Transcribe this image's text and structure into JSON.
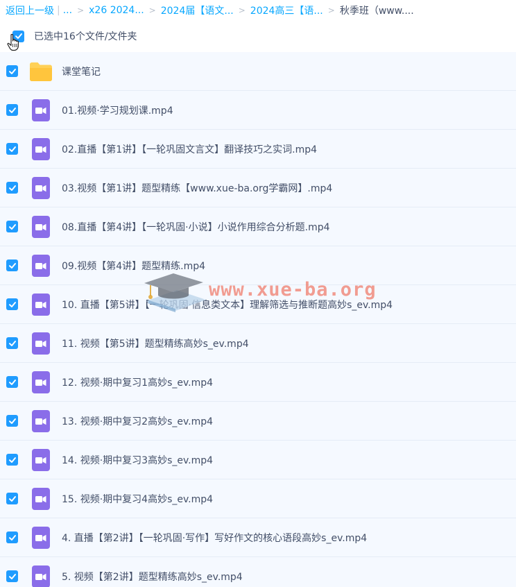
{
  "breadcrumb": {
    "back_label": "返回上一级",
    "divider": "|",
    "ellipsis": "...",
    "separator": ">",
    "items": [
      "x26 2024...",
      "2024届【语文...",
      "2024高三【语...",
      "秋季班（www...."
    ]
  },
  "selection": {
    "label": "已选中16个文件/文件夹"
  },
  "watermark": "www.xue-ba.org",
  "colors": {
    "accent": "#06a7ff",
    "checkbox": "#1f9cff",
    "row_bg": "#f5f9ff",
    "folder": "#ffd157",
    "video_icon": "#8a6de9"
  },
  "files": [
    {
      "name": "课堂笔记",
      "icon": "folder-icon"
    },
    {
      "name": "01.视频·学习规划课.mp4",
      "icon": "video-file-icon"
    },
    {
      "name": "02.直播【第1讲】【一轮巩固文言文】翻译技巧之实词.mp4",
      "icon": "video-file-icon"
    },
    {
      "name": "03.视频【第1讲】题型精练【www.xue-ba.org学霸网】.mp4",
      "icon": "video-file-icon"
    },
    {
      "name": "08.直播【第4讲】【一轮巩固·小说】小说作用综合分析题.mp4",
      "icon": "video-file-icon"
    },
    {
      "name": "09.视频【第4讲】题型精练.mp4",
      "icon": "video-file-icon"
    },
    {
      "name": "10. 直播【第5讲】【一轮巩固·信息类文本】理解筛选与推断题高妙s_ev.mp4",
      "icon": "video-file-icon"
    },
    {
      "name": "11. 视频【第5讲】题型精练高妙s_ev.mp4",
      "icon": "video-file-icon"
    },
    {
      "name": "12. 视频·期中复习1高妙s_ev.mp4",
      "icon": "video-file-icon"
    },
    {
      "name": "13. 视频·期中复习2高妙s_ev.mp4",
      "icon": "video-file-icon"
    },
    {
      "name": "14. 视频·期中复习3高妙s_ev.mp4",
      "icon": "video-file-icon"
    },
    {
      "name": "15. 视频·期中复习4高妙s_ev.mp4",
      "icon": "video-file-icon"
    },
    {
      "name": "4. 直播【第2讲】【一轮巩固·写作】写好作文的核心语段高妙s_ev.mp4",
      "icon": "video-file-icon"
    },
    {
      "name": "5. 视频【第2讲】题型精练高妙s_ev.mp4",
      "icon": "video-file-icon"
    }
  ]
}
